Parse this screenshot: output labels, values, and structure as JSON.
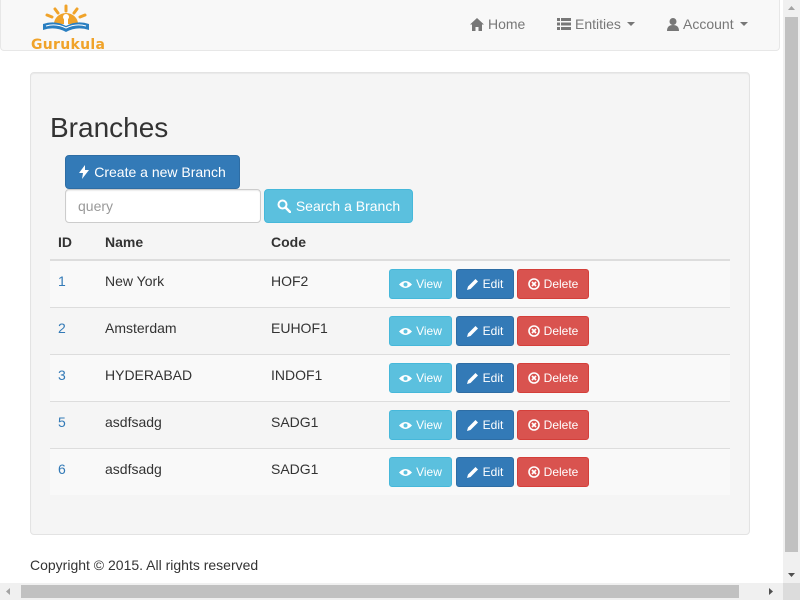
{
  "brand": {
    "name": "Gurukula",
    "colors": {
      "orange": "#f0a32a",
      "blue": "#2a7fc1"
    }
  },
  "nav": {
    "home": {
      "icon": "home-icon",
      "label": "Home"
    },
    "entities": {
      "icon": "list-icon",
      "label": "Entities"
    },
    "account": {
      "icon": "user-icon",
      "label": "Account"
    }
  },
  "page": {
    "title": "Branches",
    "create_label": "Create a new Branch",
    "search_placeholder": "query",
    "search_label": "Search a Branch"
  },
  "table": {
    "columns": [
      "ID",
      "Name",
      "Code"
    ],
    "rows": [
      {
        "id": "1",
        "name": "New York",
        "code": "HOF2"
      },
      {
        "id": "2",
        "name": "Amsterdam",
        "code": "EUHOF1"
      },
      {
        "id": "3",
        "name": "HYDERABAD",
        "code": "INDOF1"
      },
      {
        "id": "5",
        "name": "asdfsadg",
        "code": "SADG1"
      },
      {
        "id": "6",
        "name": "asdfsadg",
        "code": "SADG1"
      }
    ],
    "actions": {
      "view": "View",
      "edit": "Edit",
      "delete": "Delete"
    }
  },
  "footer": {
    "text": "Copyright © 2015. All rights reserved"
  },
  "colors": {
    "primary": "#337ab7",
    "info": "#5bc0de",
    "danger": "#d9534f",
    "link": "#337ab7"
  }
}
